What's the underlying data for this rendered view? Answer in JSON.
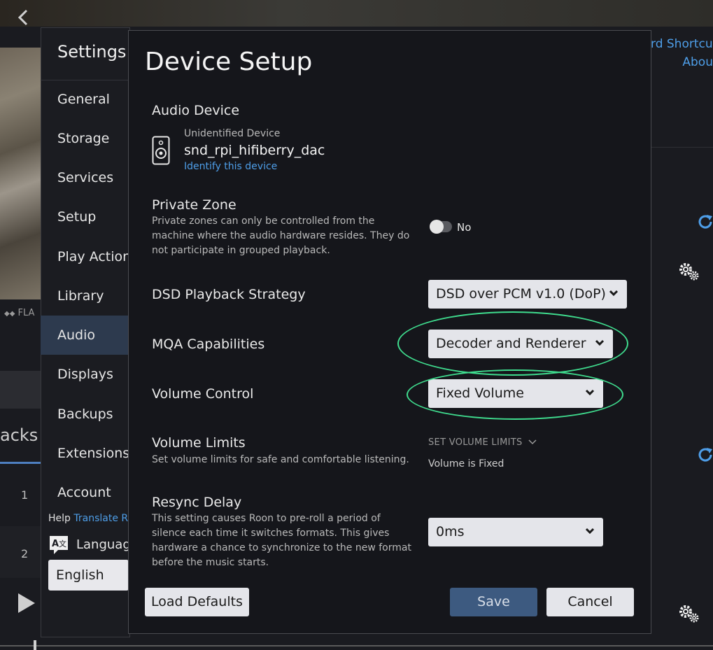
{
  "background": {
    "format_text": "FLA",
    "tracks_label": "acks",
    "track_numbers": [
      "1",
      "2"
    ],
    "right_links": [
      "rd Shortcut",
      "Abou"
    ]
  },
  "settings": {
    "title": "Settings",
    "nav": [
      {
        "label": "General",
        "active": false
      },
      {
        "label": "Storage",
        "active": false
      },
      {
        "label": "Services",
        "active": false
      },
      {
        "label": "Setup",
        "active": false
      },
      {
        "label": "Play Action",
        "active": false
      },
      {
        "label": "Library",
        "active": false
      },
      {
        "label": "Audio",
        "active": true
      },
      {
        "label": "Displays",
        "active": false
      },
      {
        "label": "Backups",
        "active": false
      },
      {
        "label": "Extensions",
        "active": false
      },
      {
        "label": "Account",
        "active": false
      }
    ],
    "help_prefix": "Help",
    "help_link": "Translate R",
    "language_label": "Languag",
    "language_value": "English"
  },
  "modal": {
    "title": "Device Setup",
    "audio_device": {
      "label": "Audio Device",
      "type": "Unidentified Device",
      "name": "snd_rpi_hifiberry_dac",
      "identify_link": "Identify this device"
    },
    "private_zone": {
      "label": "Private Zone",
      "description": "Private zones can only be controlled from the machine where the audio hardware resides. They do not participate in grouped playback.",
      "toggle_value": "No"
    },
    "dsd": {
      "label": "DSD Playback Strategy",
      "value": "DSD over PCM v1.0 (DoP)"
    },
    "mqa": {
      "label": "MQA Capabilities",
      "value": "Decoder and Renderer"
    },
    "volume_control": {
      "label": "Volume Control",
      "value": "Fixed Volume"
    },
    "volume_limits": {
      "label": "Volume Limits",
      "description": "Set volume limits for safe and comfortable listening.",
      "action": "SET VOLUME LIMITS",
      "status": "Volume is Fixed"
    },
    "resync": {
      "label": "Resync Delay",
      "description": "This setting causes Roon to pre-roll a period of silence each time it switches formats. This gives hardware a chance to synchronize to the new format before the music starts.",
      "value": "0ms"
    },
    "buttons": {
      "load_defaults": "Load Defaults",
      "save": "Save",
      "cancel": "Cancel"
    }
  },
  "colors": {
    "accent_link": "#4e9ee8",
    "save_button": "#3d5a80",
    "highlight": "#3fdc8e",
    "active_nav": "#2d3a4e"
  }
}
